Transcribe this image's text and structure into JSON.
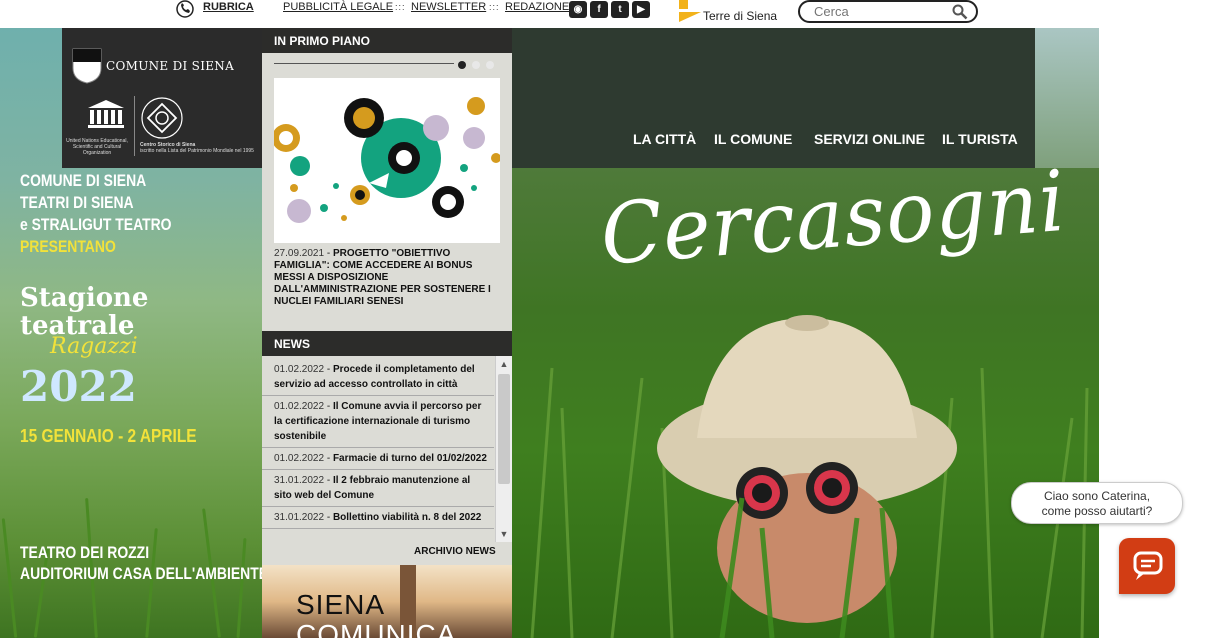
{
  "topbar": {
    "links": [
      "RUBRICA",
      "PUBBLICITÀ LEGALE",
      "NEWSLETTER",
      "REDAZIONE"
    ],
    "separator": ":::",
    "social": [
      "rss-icon",
      "facebook-icon",
      "twitter-icon",
      "youtube-icon"
    ],
    "terre_di_siena": "Terre di Siena",
    "search_placeholder": "Cerca"
  },
  "header": {
    "logo_text": "COMUNE DI SIENA",
    "unesco_caption": "United Nations Educational, Scientific and Cultural Organization",
    "centro_caption_bold": "Centro Storico di Siena",
    "centro_caption": "iscritto nella Lista del Patrimonio Mondiale nel 1995",
    "nav": [
      "LA CITTÀ",
      "IL COMUNE",
      "SERVIZI ONLINE",
      "IL TURISTA"
    ]
  },
  "poster": {
    "line1": "COMUNE DI SIENA",
    "line2": "TEATRI DI SIENA",
    "line3": "e STRALIGUT TEATRO",
    "line4": "PRESENTANO",
    "stagione": "Stagione",
    "teatrale": "teatrale",
    "ragazzi": "Ragazzi",
    "year": "2022",
    "dates": "15 GENNAIO - 2 APRILE",
    "venue1": "TEATRO DEI ROZZI",
    "venue2": "AUDITORIUM CASA DELL'AMBIENTE"
  },
  "primo_piano": {
    "heading": "IN PRIMO PIANO",
    "date": "27.09.2021",
    "title": "PROGETTO \"OBIETTIVO FAMIGLIA\": COME ACCEDERE AI BONUS MESSI A DISPOSIZIONE DALL'AMMINISTRAZIONE PER SOSTENERE I NUCLEI FAMILIARI SENESI"
  },
  "news": {
    "heading": "NEWS",
    "items": [
      {
        "date": "01.02.2022",
        "title": "Procede il completamento del servizio ad accesso controllato in città"
      },
      {
        "date": "01.02.2022",
        "title": "Il Comune avvia il percorso per la certificazione internazionale di turismo sostenibile"
      },
      {
        "date": "01.02.2022",
        "title": "Farmacie di turno del 01/02/2022"
      },
      {
        "date": "31.01.2022",
        "title": "Il 2 febbraio manutenzione al sito web del Comune"
      },
      {
        "date": "31.01.2022",
        "title": "Bollettino viabilità n. 8 del 2022"
      }
    ],
    "archive": "ARCHIVIO NEWS"
  },
  "siena_comunica": {
    "line1": "SIENA",
    "line2": "COMUNICA"
  },
  "hero": {
    "title": "Cercasogni"
  },
  "chat": {
    "line1": "Ciao sono Caterina,",
    "line2": "come posso aiutarti?"
  }
}
